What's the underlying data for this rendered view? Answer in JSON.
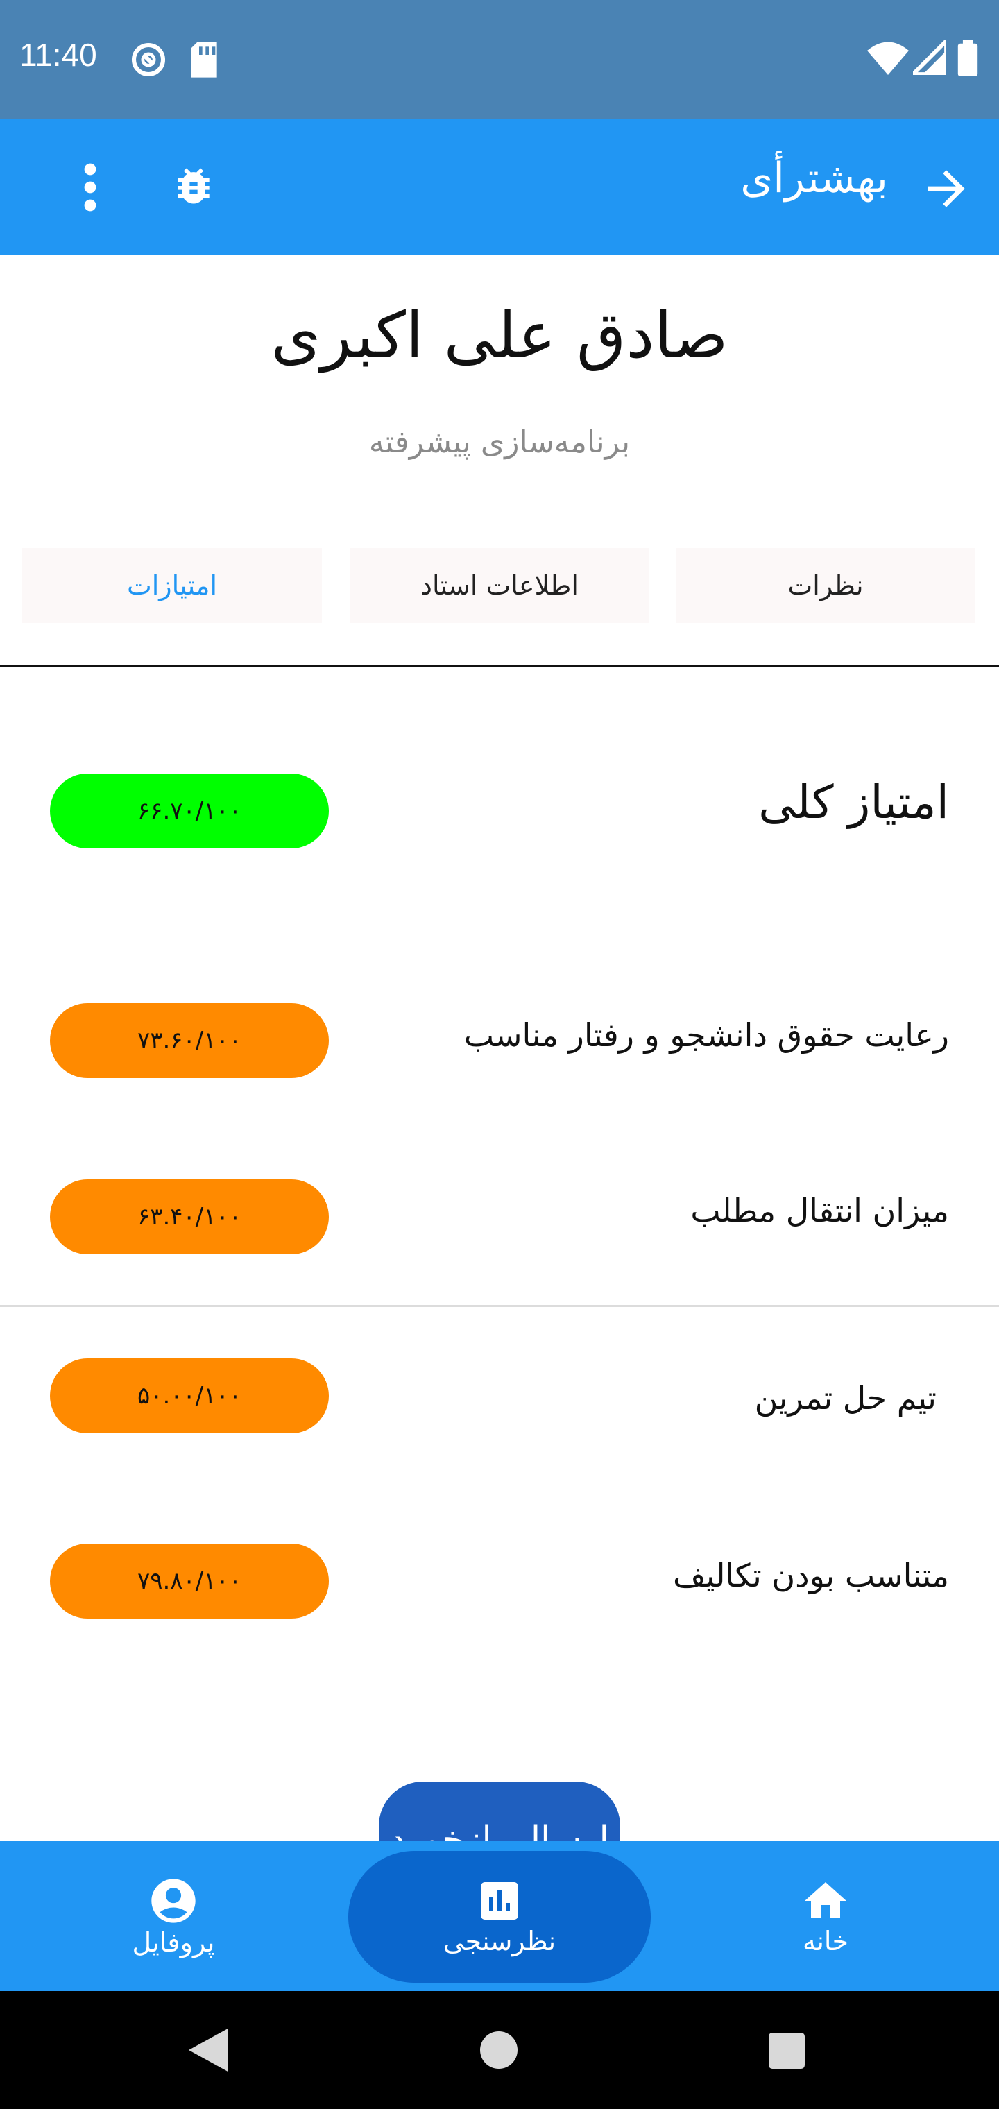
{
  "status_bar": {
    "time": "11:40"
  },
  "app_bar": {
    "title": "بهشترأی"
  },
  "header": {
    "teacher_name": "صادق علی اکبری",
    "course_name": "برنامه‌سازی پیشرفته"
  },
  "tabs": [
    {
      "label": "نظرات",
      "active": false
    },
    {
      "label": "اطلاعات استاد",
      "active": false
    },
    {
      "label": "امتیازات",
      "active": true
    }
  ],
  "overall": {
    "label": "امتیاز کلی",
    "score": "۶۶.۷۰/۱۰۰",
    "value": 66.7,
    "color": "#00ff00"
  },
  "scores": [
    {
      "label": "رعایت حقوق دانشجو و رفتار مناسب",
      "score": "۷۳.۶۰/۱۰۰",
      "value": 73.6
    },
    {
      "label": "میزان انتقال مطلب",
      "score": "۶۳.۴۰/۱۰۰",
      "value": 63.4
    },
    {
      "label": "تیم حل تمرین",
      "score": "۵۰.۰۰/۱۰۰",
      "value": 50.0
    },
    {
      "label": "متناسب بودن تکالیف",
      "score": "۷۹.۸۰/۱۰۰",
      "value": 79.8
    }
  ],
  "submit_button": {
    "label": "ارسال بازخورد"
  },
  "bottom_nav": [
    {
      "label": "خانه",
      "icon": "home-icon",
      "active": false
    },
    {
      "label": "نظرسنجی",
      "icon": "poll-icon",
      "active": true
    },
    {
      "label": "پروفایل",
      "icon": "profile-icon",
      "active": false
    }
  ],
  "colors": {
    "primary": "#2196f3",
    "status_bar": "#4a83b4",
    "active_tab": "#2196f3",
    "score_orange": "#ff8a00",
    "score_green": "#00ff00"
  }
}
